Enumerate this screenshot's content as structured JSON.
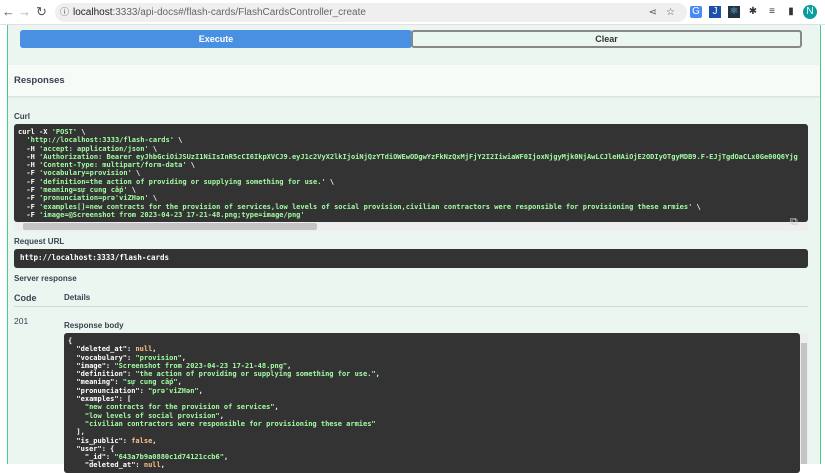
{
  "browser": {
    "url_host": "localhost",
    "url_rest": ":3333/api-docs#/flash-cards/FlashCardsController_create",
    "profile_initial": "N"
  },
  "actions": {
    "execute": "Execute",
    "clear": "Clear"
  },
  "responses_title": "Responses",
  "curl": {
    "label": "Curl",
    "lines": [
      "curl -X 'POST' \\",
      "  'http://localhost:3333/flash-cards' \\",
      "  -H 'accept: application/json' \\",
      "  -H 'Authorization: Bearer eyJhbGciOiJSUzI1NiIsInR5cCI6IkpXVCJ9.eyJ1c2VyX2lkIjoiNjQzYTdiOWEwODgwYzFkNzQxMjFjY2I2IiwiaWF0IjoxNjgyMjk0NjAwLCJleHAiOjE2ODIyOTgyMDB9.F-EJjTgdOaCLx0Ge00Q6Yjg",
      "  -H 'Content-Type: multipart/form-data' \\",
      "  -F 'vocabulary=provision' \\",
      "  -F 'definition=the action of providing or supplying something for use.' \\",
      "  -F 'meaning=sự cung cấp' \\",
      "  -F 'pronunciation=prə'viZHən' \\",
      "  -F 'examples[]=new contracts for the provision of services,low levels of social provision,civilian contractors were responsible for provisioning these armies' \\",
      "  -F 'image=@Screenshot from 2023-04-23 17-21-48.png;type=image/png'"
    ]
  },
  "request_url": {
    "label": "Request URL",
    "value": "http://localhost:3333/flash-cards"
  },
  "server_response": {
    "label": "Server response",
    "col_code": "Code",
    "col_details": "Details",
    "code": "201",
    "body_label": "Response body"
  },
  "body": [
    {
      "t": "{"
    },
    {
      "k": "  \"deleted_at\": ",
      "v": "null",
      "c": "nul",
      "e": ","
    },
    {
      "k": "  \"vocabulary\": ",
      "v": "\"provision\"",
      "c": "str",
      "e": ","
    },
    {
      "k": "  \"image\": ",
      "v": "\"Screenshot from 2023-04-23 17-21-48.png\"",
      "c": "str",
      "e": ","
    },
    {
      "k": "  \"definition\": ",
      "v": "\"the action of providing or supplying something for use.\"",
      "c": "str",
      "e": ","
    },
    {
      "k": "  \"meaning\": ",
      "v": "\"sự cung cấp\"",
      "c": "str",
      "e": ","
    },
    {
      "k": "  \"pronunciation\": ",
      "v": "\"prə'viZHən\"",
      "c": "str",
      "e": ","
    },
    {
      "k": "  \"examples\": [",
      "v": "",
      "c": "str",
      "e": ""
    },
    {
      "k": "    ",
      "v": "\"new contracts for the provision of services\"",
      "c": "str",
      "e": ","
    },
    {
      "k": "    ",
      "v": "\"low levels of social provision\"",
      "c": "str",
      "e": ","
    },
    {
      "k": "    ",
      "v": "\"civilian contractors were responsible for provisioning these armies\"",
      "c": "str",
      "e": ""
    },
    {
      "t": "  ],"
    },
    {
      "k": "  \"is_public\": ",
      "v": "false",
      "c": "nul",
      "e": ","
    },
    {
      "k": "  \"user\": {",
      "v": "",
      "c": "str",
      "e": ""
    },
    {
      "k": "    \"_id\": ",
      "v": "\"643a7b9a0880c1d74121ccb6\"",
      "c": "str",
      "e": ","
    },
    {
      "k": "    \"deleted_at\": ",
      "v": "null",
      "c": "nul",
      "e": ","
    }
  ]
}
